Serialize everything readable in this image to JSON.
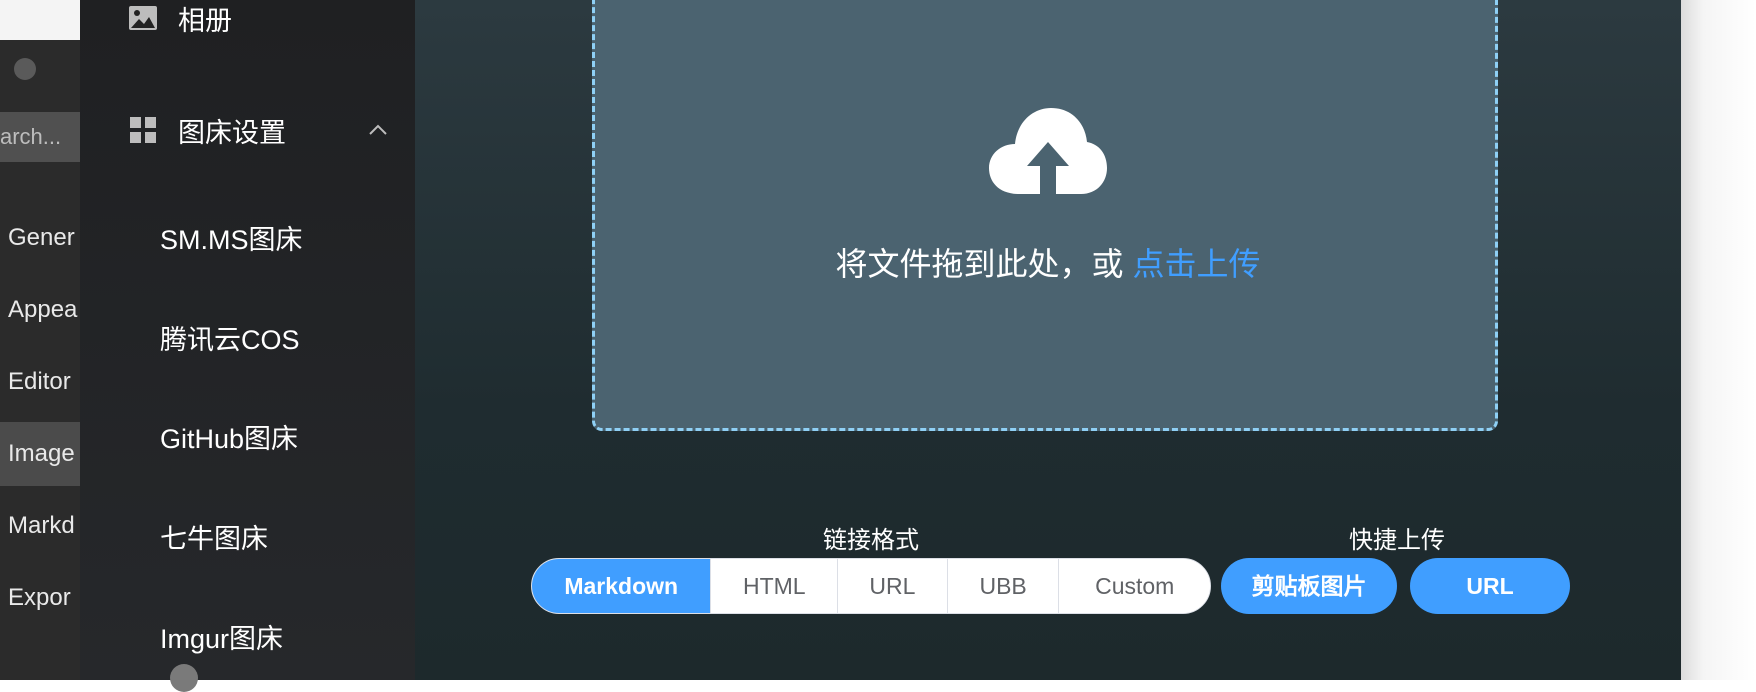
{
  "background_window": {
    "search_placeholder": "arch...",
    "items": [
      "Gener",
      "Appea",
      "Editor",
      "Image",
      "Markd",
      "Expor"
    ]
  },
  "sidebar": {
    "album_label": "相册",
    "settings_label": "图床设置",
    "sub_items": [
      "SM.MS图床",
      "腾讯云COS",
      "GitHub图床",
      "七牛图床",
      "Imgur图床"
    ]
  },
  "upload": {
    "drop_text": "将文件拖到此处，或 ",
    "drop_link": "点击上传"
  },
  "link_format": {
    "caption": "链接格式",
    "options": [
      "Markdown",
      "HTML",
      "URL",
      "UBB",
      "Custom"
    ],
    "selected": "Markdown"
  },
  "quick_upload": {
    "caption": "快捷上传",
    "clipboard_label": "剪贴板图片",
    "url_label": "URL"
  },
  "colors": {
    "accent": "#409eff",
    "dropzone_bg": "#4b6370",
    "dropzone_border": "#8fd0f5"
  }
}
